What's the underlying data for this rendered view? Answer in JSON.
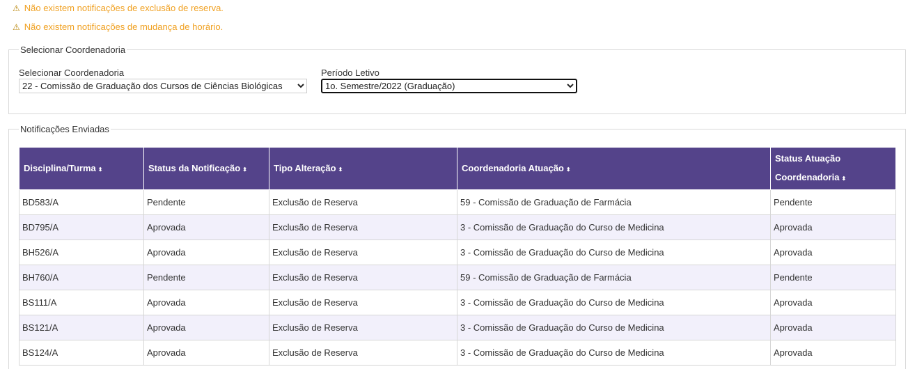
{
  "alerts": {
    "reserva": "Não existem notificações de exclusão de reserva.",
    "horario": "Não existem notificações de mudança de horário."
  },
  "icons": {
    "warning": "⚠",
    "sort": "⬍"
  },
  "colors": {
    "header_bg": "#54438a",
    "alert_text": "#f0a020",
    "row_alt": "#f2f0fb"
  },
  "filter": {
    "legend": "Selecionar Coordenadoria",
    "coordenadoria_label": "Selecionar Coordenadoria",
    "coordenadoria_value": "22 - Comissão de Graduação dos Cursos de Ciências Biológicas",
    "periodo_label": "Período Letivo",
    "periodo_value": "1o. Semestre/2022 (Graduação)"
  },
  "notifications": {
    "legend": "Notificações Enviadas",
    "headers": [
      "Disciplina/Turma",
      "Status da Notificação",
      "Tipo Alteração",
      "Coordenadoria Atuação",
      "Status Atuação Coordenadoria"
    ],
    "rows": [
      [
        "BD583/A",
        "Pendente",
        "Exclusão de Reserva",
        "59 - Comissão de Graduação de Farmácia",
        "Pendente"
      ],
      [
        "BD795/A",
        "Aprovada",
        "Exclusão de Reserva",
        "3 - Comissão de Graduação do Curso de Medicina",
        "Aprovada"
      ],
      [
        "BH526/A",
        "Aprovada",
        "Exclusão de Reserva",
        "3 - Comissão de Graduação do Curso de Medicina",
        "Aprovada"
      ],
      [
        "BH760/A",
        "Pendente",
        "Exclusão de Reserva",
        "59 - Comissão de Graduação de Farmácia",
        "Pendente"
      ],
      [
        "BS111/A",
        "Aprovada",
        "Exclusão de Reserva",
        "3 - Comissão de Graduação do Curso de Medicina",
        "Aprovada"
      ],
      [
        "BS121/A",
        "Aprovada",
        "Exclusão de Reserva",
        "3 - Comissão de Graduação do Curso de Medicina",
        "Aprovada"
      ],
      [
        "BS124/A",
        "Aprovada",
        "Exclusão de Reserva",
        "3 - Comissão de Graduação do Curso de Medicina",
        "Aprovada"
      ]
    ]
  }
}
